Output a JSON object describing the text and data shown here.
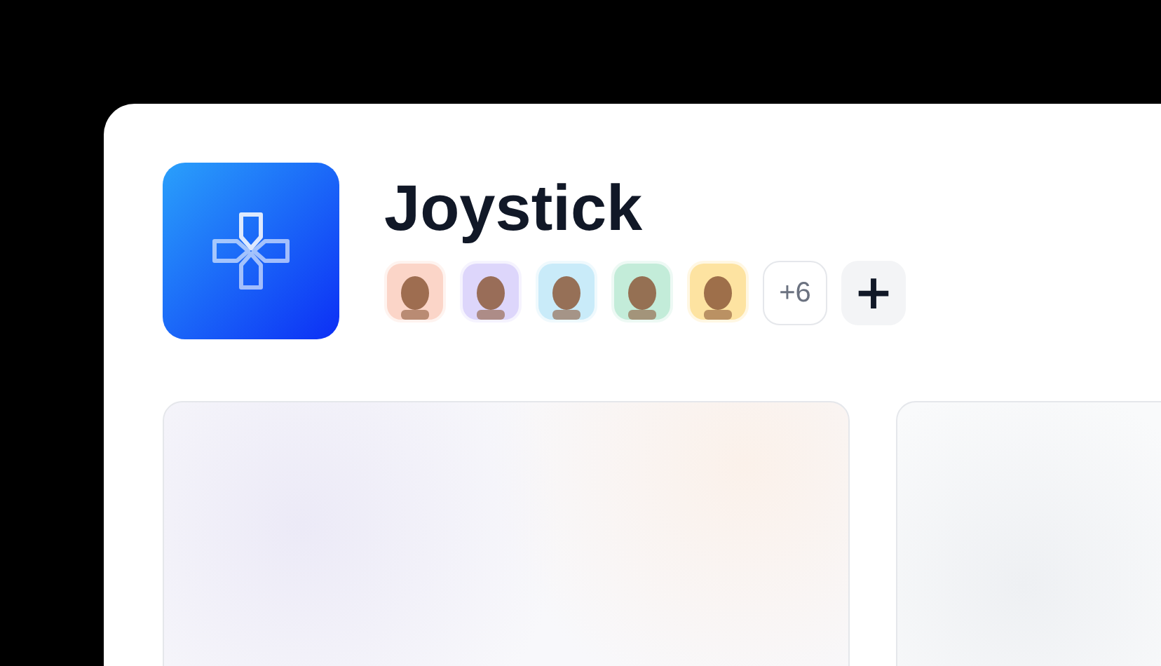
{
  "project": {
    "title": "Joystick"
  },
  "members": [
    {
      "color": "#fbd5c8"
    },
    {
      "color": "#ddd6fb"
    },
    {
      "color": "#c9ebf9"
    },
    {
      "color": "#c3ecd9"
    },
    {
      "color": "#fde3a1"
    }
  ],
  "more_members": "+6",
  "add_button": "+"
}
